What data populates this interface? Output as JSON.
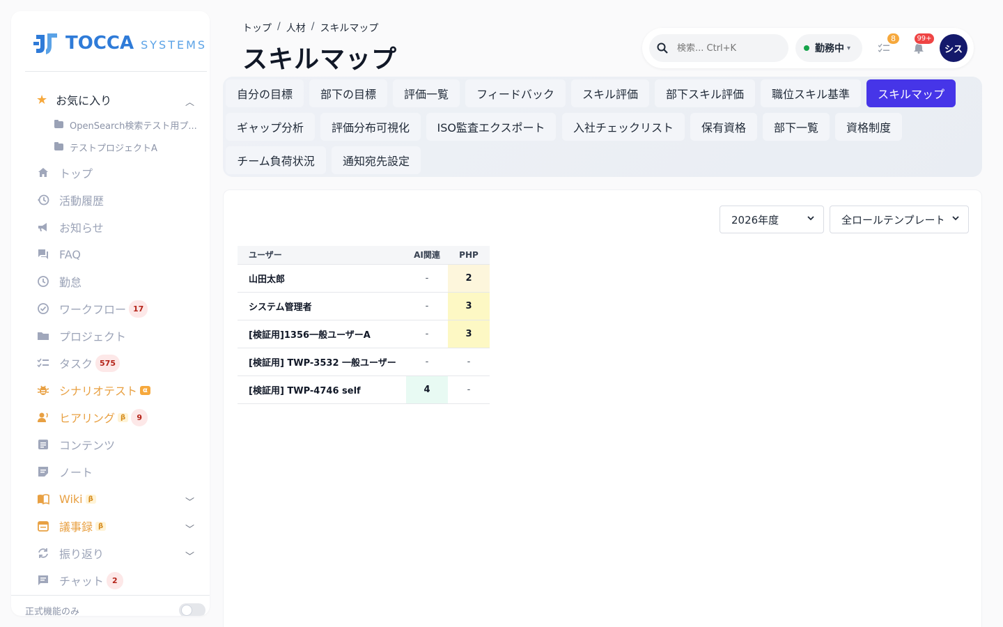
{
  "brand": {
    "name": "TOCCA",
    "sub": "SYSTEMS"
  },
  "sidebar": {
    "favorites_label": "お気に入り",
    "favorites": [
      {
        "label": "OpenSearch検索テスト用プ..."
      },
      {
        "label": "テストプロジェクトA"
      }
    ],
    "items": [
      {
        "label": "トップ",
        "icon": "home-icon"
      },
      {
        "label": "活動履歴",
        "icon": "history-icon"
      },
      {
        "label": "お知らせ",
        "icon": "megaphone-icon"
      },
      {
        "label": "FAQ",
        "icon": "forum-icon"
      },
      {
        "label": "勤怠",
        "icon": "clock-icon"
      },
      {
        "label": "ワークフロー",
        "icon": "check-circle-icon",
        "count": "17"
      },
      {
        "label": "プロジェクト",
        "icon": "folder-icon"
      },
      {
        "label": "タスク",
        "icon": "checklist-icon",
        "count": "575"
      },
      {
        "label": "シナリオテスト",
        "icon": "bug-icon",
        "tag": "α"
      },
      {
        "label": "ヒアリング",
        "icon": "people-voice-icon",
        "tag": "β",
        "count": "9"
      },
      {
        "label": "コンテンツ",
        "icon": "article-icon"
      },
      {
        "label": "ノート",
        "icon": "note-icon"
      },
      {
        "label": "Wiki",
        "icon": "book-icon",
        "tag": "β"
      },
      {
        "label": "議事録",
        "icon": "calendar-icon",
        "tag": "β"
      },
      {
        "label": "振り返り",
        "icon": "refresh-icon"
      },
      {
        "label": "チャット",
        "icon": "chat-icon",
        "count": "2"
      }
    ],
    "footer_label": "正式機能のみ"
  },
  "header": {
    "breadcrumb": [
      "トップ",
      "人材",
      "スキルマップ"
    ],
    "title": "スキルマップ",
    "search_placeholder": "検索... Ctrl+K",
    "status": "勤務中",
    "task_badge": "8",
    "notif_badge": "99+",
    "avatar": "シス"
  },
  "tabs": [
    "自分の目標",
    "部下の目標",
    "評価一覧",
    "フィードバック",
    "スキル評価",
    "部下スキル評価",
    "職位スキル基準",
    "スキルマップ",
    "ギャップ分析",
    "評価分布可視化",
    "ISO監査エクスポート",
    "入社チェックリスト",
    "保有資格",
    "部下一覧",
    "資格制度",
    "チーム負荷状況",
    "通知宛先設定"
  ],
  "active_tab": "スキルマップ",
  "filters": {
    "year": "2026年度",
    "template": "全ロールテンプレート"
  },
  "table": {
    "headers": [
      "ユーザー",
      "AI関連",
      "PHP"
    ],
    "rows": [
      {
        "user": "山田太郎",
        "ai": "-",
        "php": "2"
      },
      {
        "user": "システム管理者",
        "ai": "-",
        "php": "3"
      },
      {
        "user": "[検証用]1356一般ユーザーA",
        "ai": "-",
        "php": "3"
      },
      {
        "user": "[検証用] TWP-3532 一般ユーザー",
        "ai": "-",
        "php": "-"
      },
      {
        "user": "[検証用] TWP-4746 self",
        "ai": "4",
        "php": "-"
      }
    ]
  },
  "colors": {
    "accent": "#4635e8",
    "brand": "#2f7bd8",
    "favorite": "#f6a83c",
    "level2": "#fdf6dc",
    "level3": "#fdf8c4",
    "level4": "#e8faf3"
  }
}
